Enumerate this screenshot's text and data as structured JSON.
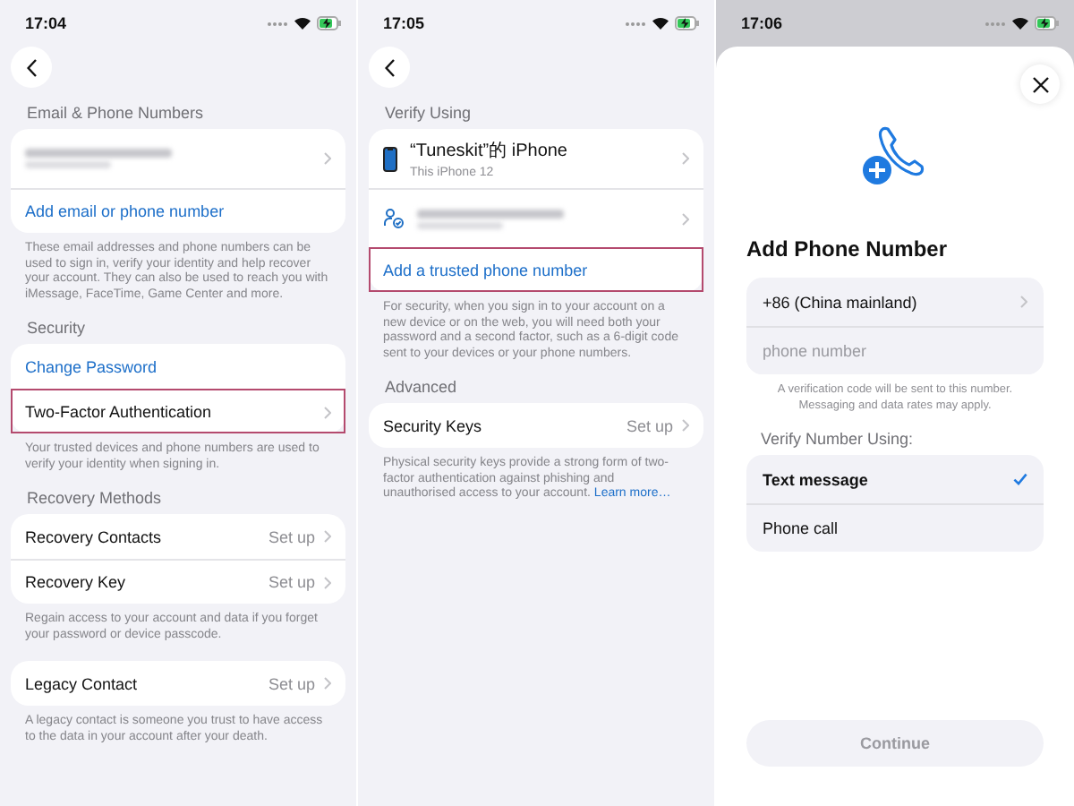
{
  "screens": [
    {
      "kind": "settings",
      "time": "17:04",
      "sections": [
        {
          "header": "Email & Phone Numbers",
          "rows": [
            {
              "kind": "redacted",
              "highlighted": false
            },
            {
              "kind": "link",
              "label": "Add email or phone number",
              "highlighted": false
            }
          ],
          "footer": "These email addresses and phone numbers can be used to sign in, verify your identity and help recover your account. They can also be used to reach you with iMessage, FaceTime, Game Center and more."
        },
        {
          "header": "Security",
          "rows": [
            {
              "kind": "link",
              "label": "Change Password",
              "highlighted": false
            },
            {
              "kind": "nav",
              "label": "Two-Factor Authentication",
              "highlighted": true
            }
          ],
          "footer": "Your trusted devices and phone numbers are used to verify your identity when signing in."
        },
        {
          "header": "Recovery Methods",
          "rows": [
            {
              "kind": "nav",
              "label": "Recovery Contacts",
              "value": "Set up",
              "highlighted": false
            },
            {
              "kind": "nav",
              "label": "Recovery Key",
              "value": "Set up",
              "highlighted": false
            }
          ],
          "footer": "Regain access to your account and data if you forget your password or device passcode."
        },
        {
          "rows": [
            {
              "kind": "nav",
              "label": "Legacy Contact",
              "value": "Set up",
              "highlighted": false
            }
          ],
          "footer": "A legacy contact is someone you trust to have access to the data in your account after your death."
        }
      ]
    },
    {
      "kind": "settings",
      "time": "17:05",
      "sections": [
        {
          "header": "Verify Using",
          "rows": [
            {
              "kind": "device",
              "label": "“Tuneskit”的 iPhone",
              "detail": "This iPhone 12",
              "highlighted": false
            },
            {
              "kind": "redacted_number",
              "highlighted": false
            },
            {
              "kind": "link",
              "label": "Add a trusted phone number",
              "highlighted": true
            }
          ],
          "footer": "For security, when you sign in to your account on a new device or on the web, you will need both your password and a second factor, such as a 6-digit code sent to your devices or your phone numbers."
        },
        {
          "header": "Advanced",
          "rows": [
            {
              "kind": "nav",
              "label": "Security Keys",
              "value": "Set up",
              "highlighted": false
            }
          ],
          "footer": "Physical security keys provide a strong form of two-factor authentication against phishing and unauthorised access to your account.",
          "footer_link": "Learn more…"
        }
      ]
    },
    {
      "kind": "sheet",
      "time": "17:06",
      "title": "Add Phone Number",
      "country": "+86 (China mainland)",
      "phone_placeholder": "phone number",
      "note": [
        "A verification code will be sent to this number.",
        "Messaging and data rates may apply."
      ],
      "options_header": "Verify Number Using:",
      "options": [
        {
          "label": "Text message",
          "selected": true
        },
        {
          "label": "Phone call",
          "selected": false
        }
      ],
      "button": {
        "label": "Continue",
        "disabled": true
      }
    }
  ]
}
